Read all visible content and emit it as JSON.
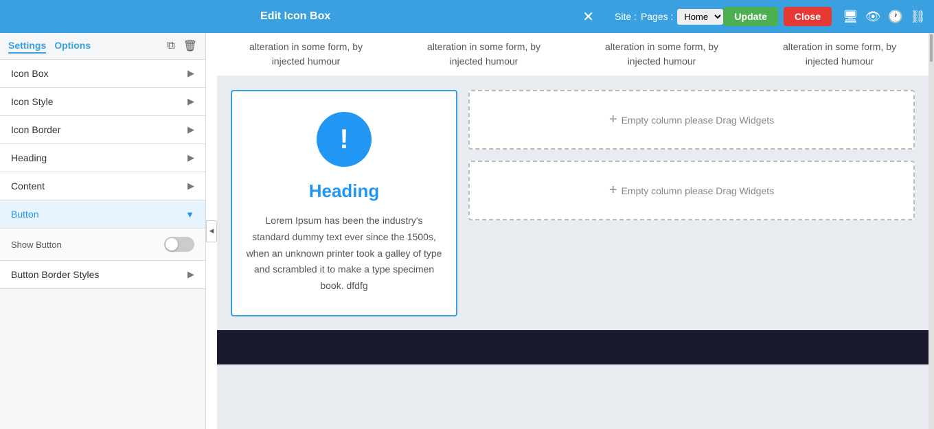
{
  "header": {
    "title": "Edit Icon Box",
    "close_symbol": "✕",
    "site_label": "Site :",
    "pages_label": "Pages :",
    "pages_value": "Home",
    "update_label": "Update",
    "close_label": "Close"
  },
  "sidebar": {
    "tab_settings": "Settings",
    "tab_options": "Options",
    "items": [
      {
        "id": "icon-box",
        "label": "Icon Box",
        "expanded": false
      },
      {
        "id": "icon-style",
        "label": "Icon Style",
        "expanded": false
      },
      {
        "id": "icon-border",
        "label": "Icon Border",
        "expanded": false
      },
      {
        "id": "heading",
        "label": "Heading",
        "expanded": false
      },
      {
        "id": "content",
        "label": "Content",
        "expanded": false
      },
      {
        "id": "button",
        "label": "Button",
        "expanded": true
      },
      {
        "id": "button-border",
        "label": "Button Border Styles",
        "expanded": false
      }
    ],
    "show_button_label": "Show Button"
  },
  "top_strip": {
    "cols": [
      {
        "line1": "alteration in some form, by",
        "line2": "injected humour"
      },
      {
        "line1": "alteration in some form, by",
        "line2": "injected humour"
      },
      {
        "line1": "alteration in some form, by",
        "line2": "injected humour"
      },
      {
        "line1": "alteration in some form, by",
        "line2": "injected humour"
      }
    ]
  },
  "card": {
    "icon_symbol": "!",
    "heading": "Heading",
    "body": "Lorem Ipsum has been the industry's standard dummy text ever since the 1500s, when an unknown printer took a galley of type and scrambled it to make a type specimen book. dfdfg"
  },
  "empty_cols": [
    {
      "label": "Empty column please Drag Widgets"
    },
    {
      "label": "Empty column please Drag Widgets"
    }
  ],
  "collapse_symbol": "◀"
}
